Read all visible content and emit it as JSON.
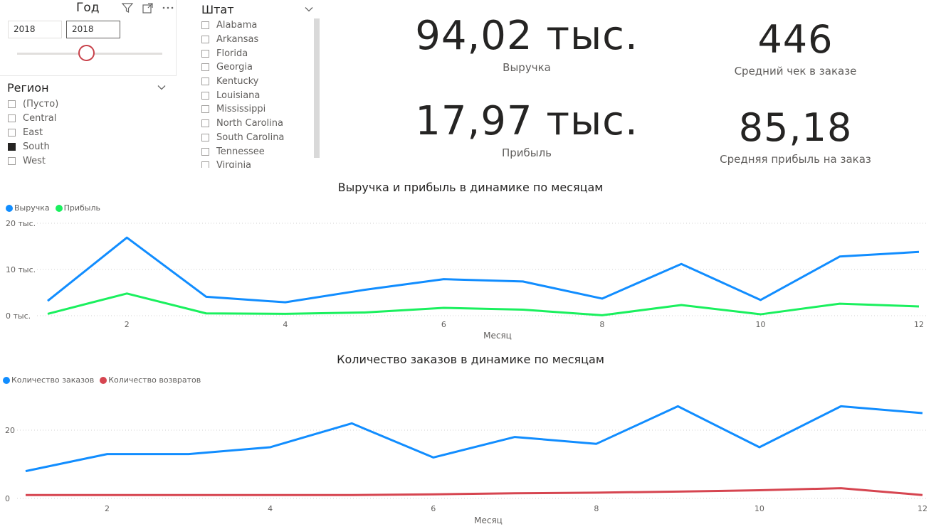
{
  "year_slicer": {
    "title": "Год",
    "from": "2018",
    "to": "2018",
    "icons": [
      "filter-icon",
      "focus-mode-icon",
      "more-options-icon"
    ]
  },
  "region_slicer": {
    "title": "Регион",
    "items": [
      {
        "label": "(Пусто)",
        "checked": false
      },
      {
        "label": "Central",
        "checked": false
      },
      {
        "label": "East",
        "checked": false
      },
      {
        "label": "South",
        "checked": true
      },
      {
        "label": "West",
        "checked": false
      }
    ]
  },
  "state_slicer": {
    "title": "Штат",
    "items": [
      "Alabama",
      "Arkansas",
      "Florida",
      "Georgia",
      "Kentucky",
      "Louisiana",
      "Mississippi",
      "North Carolina",
      "South Carolina",
      "Tennessee",
      "Virginia"
    ]
  },
  "kpis": {
    "revenue": {
      "value": "94,02 тыс.",
      "label": "Выручка"
    },
    "avg_check": {
      "value": "446",
      "label": "Средний чек в заказе"
    },
    "profit": {
      "value": "17,97 тыс.",
      "label": "Прибыль"
    },
    "avg_profit": {
      "value": "85,18",
      "label": "Средняя прибыль на заказ"
    }
  },
  "colors": {
    "revenue": "#118DFF",
    "profit": "#1AF05E",
    "orders": "#118DFF",
    "returns": "#D64550",
    "grid": "#dcdcdc",
    "slider_thumb": "#c8414a"
  },
  "chart_data": [
    {
      "type": "line",
      "title": "Выручка и прибыль в динамике по месяцам",
      "xlabel": "Месяц",
      "ylabel": "",
      "x": [
        1,
        2,
        3,
        4,
        5,
        6,
        7,
        8,
        9,
        10,
        11,
        12
      ],
      "x_ticks": [
        2,
        4,
        6,
        8,
        10,
        12
      ],
      "y_ticks": [
        0,
        10000,
        20000
      ],
      "y_tick_labels": [
        "0 тыс.",
        "10 тыс.",
        "20 тыс."
      ],
      "ylim": [
        0,
        20000
      ],
      "grid": true,
      "legend_position": "top-left",
      "series": [
        {
          "name": "Выручка",
          "color": "#118DFF",
          "values": [
            3200,
            16900,
            4100,
            2900,
            5600,
            7900,
            7400,
            3700,
            11200,
            3400,
            12800,
            13800
          ]
        },
        {
          "name": "Прибыль",
          "color": "#1AF05E",
          "values": [
            400,
            4800,
            500,
            400,
            700,
            1700,
            1300,
            100,
            2300,
            300,
            2600,
            2000
          ]
        }
      ]
    },
    {
      "type": "line",
      "title": "Количество заказов в динамике по месяцам",
      "xlabel": "Месяц",
      "ylabel": "",
      "x": [
        1,
        2,
        3,
        4,
        5,
        6,
        7,
        8,
        9,
        10,
        11,
        12
      ],
      "x_ticks": [
        2,
        4,
        6,
        8,
        10,
        12
      ],
      "y_ticks": [
        0,
        20
      ],
      "y_tick_labels": [
        "0",
        "20"
      ],
      "ylim": [
        0,
        30
      ],
      "grid": true,
      "legend_position": "top-left",
      "series": [
        {
          "name": "Количество заказов",
          "color": "#118DFF",
          "values": [
            8,
            13,
            13,
            15,
            22,
            12,
            18,
            16,
            27,
            15,
            27,
            25
          ]
        },
        {
          "name": "Количество возвратов",
          "color": "#D64550",
          "values": [
            1,
            1,
            1,
            1,
            1,
            1.2,
            1.5,
            1.7,
            2,
            2.4,
            3,
            1
          ]
        }
      ]
    }
  ]
}
